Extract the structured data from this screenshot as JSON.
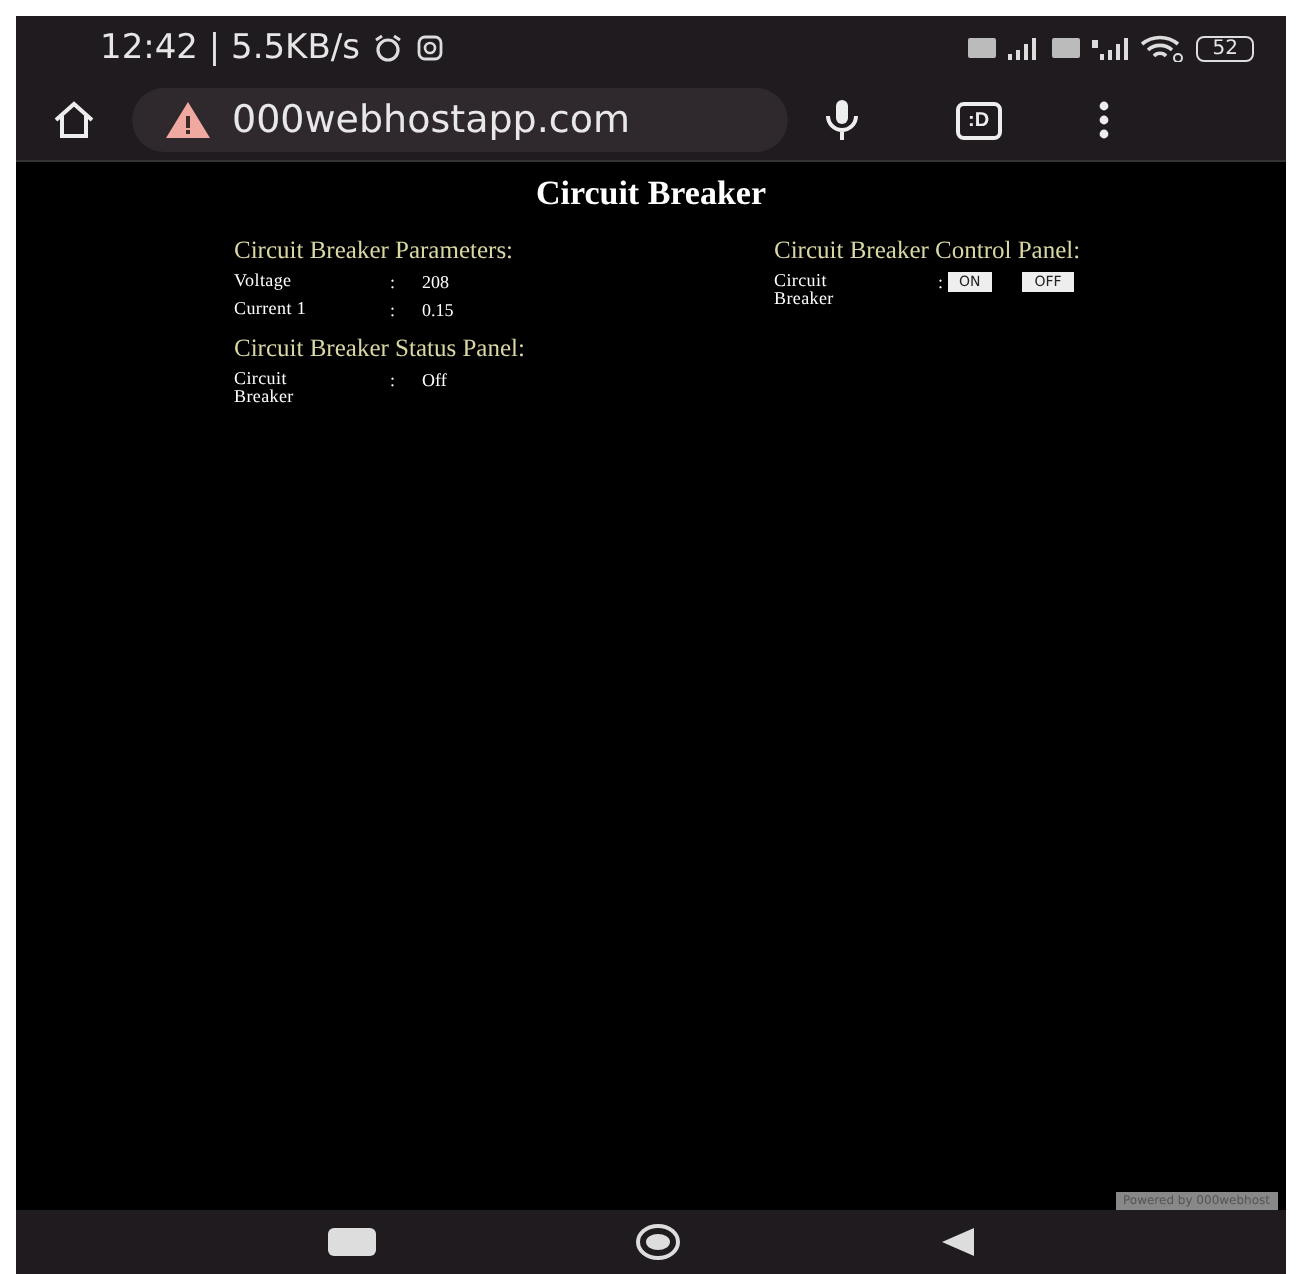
{
  "status_bar": {
    "time": "12:42 | 5.5KB/s",
    "battery": "52"
  },
  "address_bar": {
    "url": "000webhostapp.com",
    "tabs_button": ":D"
  },
  "page": {
    "title": "Circuit Breaker",
    "parameters": {
      "heading": "Circuit Breaker Parameters:",
      "rows": [
        {
          "label": "Voltage",
          "separator": ":",
          "value": "208"
        },
        {
          "label": "Current 1",
          "separator": ":",
          "value": "0.15"
        }
      ]
    },
    "status_panel": {
      "heading": "Circuit Breaker Status Panel:",
      "rows": [
        {
          "label": "Circuit Breaker",
          "separator": ":",
          "value": "Off"
        }
      ]
    },
    "control_panel": {
      "heading": "Circuit Breaker Control Panel:",
      "label": "Circuit Breaker",
      "separator": ":",
      "buttons": [
        "ON",
        "OFF"
      ]
    },
    "badge": "Powered by 000webhost"
  }
}
